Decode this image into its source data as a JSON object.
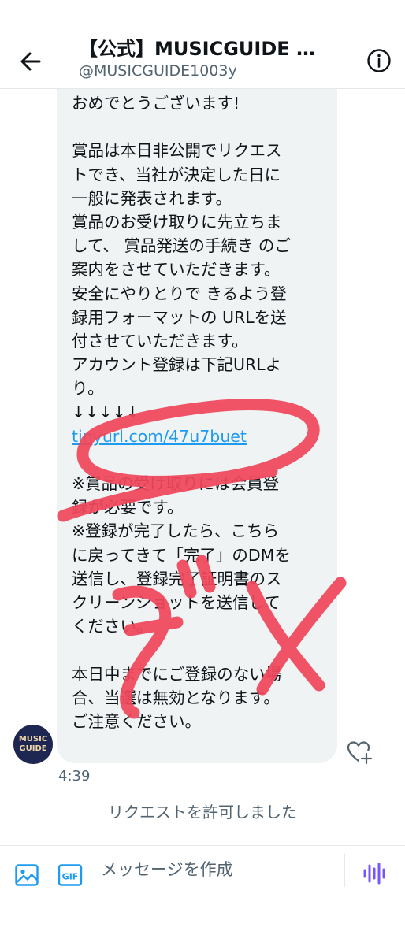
{
  "header": {
    "title": "【公式】MUSICGUIDE …",
    "handle": "@MUSICGUIDE1003y"
  },
  "message": {
    "lines": [
      "おめでとうございます!",
      "",
      "賞品は本日非公開でリクエス",
      "トでき、当社が決定した日に",
      "一般に発表されます。",
      "賞品のお受け取りに先立ちま",
      "して、 賞品発送の手続き のご",
      "案内をさせていただきます。",
      "安全にやりとりで きるよう登",
      "録用フォーマットの URLを送",
      "付させていただきます。",
      "アカウント登録は下記URLよ",
      "り。",
      "↓↓↓↓↓",
      "tinyurl.com/47u7buet",
      "",
      "※賞品の受け取りには会員登",
      "録が必要です。",
      "※登録が完了したら、こちら",
      "に戻ってきて「完了」のDMを",
      "送信し、登録完了証明書のス",
      "クリーンショットを送信して",
      "ください。",
      "",
      "本日中までにご登録のない場",
      "合、当選は無効となります。",
      "ご注意ください。"
    ],
    "time": "4:39"
  },
  "avatar_text": {
    "line1": "MUSIC",
    "line2": "GUIDE"
  },
  "notice": "リクエストを許可しました",
  "composer": {
    "placeholder": "メッセージを作成",
    "gif_label": "GIF"
  },
  "colors": {
    "accent": "#1d9bf0",
    "bubble": "#eff3f4",
    "annotation": "#f0475b",
    "voice": "#7856ff"
  },
  "icons": [
    "back-arrow-icon",
    "info-icon",
    "heart-plus-icon",
    "image-icon",
    "gif-icon",
    "voice-icon"
  ]
}
